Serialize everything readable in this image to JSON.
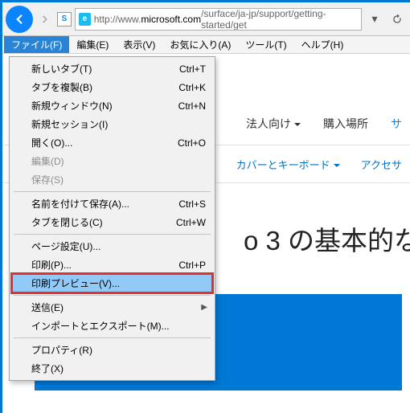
{
  "address": {
    "prefix": "http://www.",
    "domain": "microsoft.com",
    "path": "/surface/ja-jp/support/getting-started/get"
  },
  "menuBar": {
    "file": "ファイル(F)",
    "edit": "編集(E)",
    "view": "表示(V)",
    "favorites": "お気に入り(A)",
    "tools": "ツール(T)",
    "help": "ヘルプ(H)"
  },
  "fileMenu": {
    "newTab": {
      "label": "新しいタブ(T)",
      "shortcut": "Ctrl+T"
    },
    "dupTab": {
      "label": "タブを複製(B)",
      "shortcut": "Ctrl+K"
    },
    "newWindow": {
      "label": "新規ウィンドウ(N)",
      "shortcut": "Ctrl+N"
    },
    "newSession": {
      "label": "新規セッション(I)",
      "shortcut": ""
    },
    "open": {
      "label": "開く(O)...",
      "shortcut": "Ctrl+O"
    },
    "editDoc": {
      "label": "編集(D)",
      "shortcut": "",
      "disabled": true
    },
    "save": {
      "label": "保存(S)",
      "shortcut": "",
      "disabled": true
    },
    "saveAs": {
      "label": "名前を付けて保存(A)...",
      "shortcut": "Ctrl+S"
    },
    "closeTab": {
      "label": "タブを閉じる(C)",
      "shortcut": "Ctrl+W"
    },
    "pageSetup": {
      "label": "ページ設定(U)...",
      "shortcut": ""
    },
    "print": {
      "label": "印刷(P)...",
      "shortcut": "Ctrl+P"
    },
    "printPreview": {
      "label": "印刷プレビュー(V)...",
      "shortcut": ""
    },
    "send": {
      "label": "送信(E)",
      "shortcut": "",
      "submenu": true
    },
    "importExport": {
      "label": "インポートとエクスポート(M)...",
      "shortcut": ""
    },
    "properties": {
      "label": "プロパティ(R)",
      "shortcut": ""
    },
    "exit": {
      "label": "終了(X)",
      "shortcut": ""
    }
  },
  "pageContent": {
    "navCorporate": "法人向け",
    "navBuy": "購入場所",
    "navHighlighted": "サ",
    "linkCovers": "カバーとキーボード",
    "linkAccessories": "アクセサ",
    "heading": "o 3 の基本的な"
  }
}
